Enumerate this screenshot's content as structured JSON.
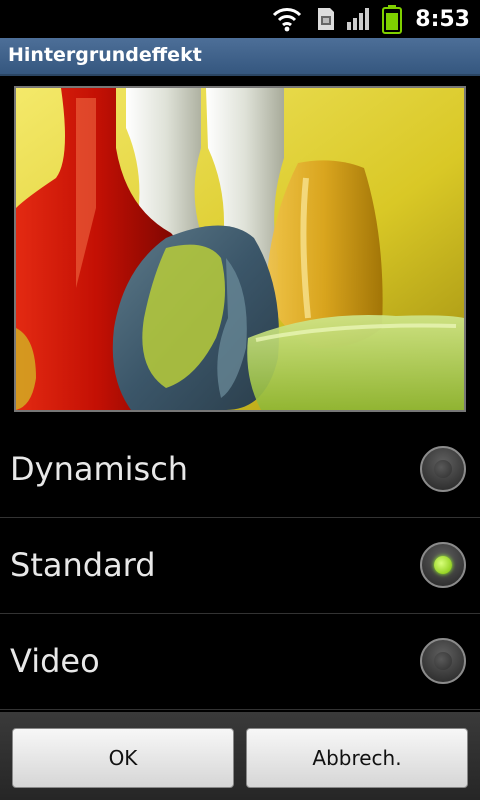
{
  "statusbar": {
    "time": "8:53",
    "icons": [
      "wifi-icon",
      "sim-card-icon",
      "signal-bars-icon",
      "battery-icon"
    ],
    "battery_color": "#7fd000"
  },
  "dialog": {
    "title": "Hintergrundeffekt",
    "title_bar_color": "#3f6189",
    "preview": {
      "description_icon": "glass-vases-wallpaper-image"
    },
    "options": [
      {
        "label": "Dynamisch",
        "checked": false
      },
      {
        "label": "Standard",
        "checked": true
      },
      {
        "label": "Video",
        "checked": false
      }
    ],
    "buttons": {
      "ok_label": "OK",
      "cancel_label": "Abbrech."
    }
  }
}
